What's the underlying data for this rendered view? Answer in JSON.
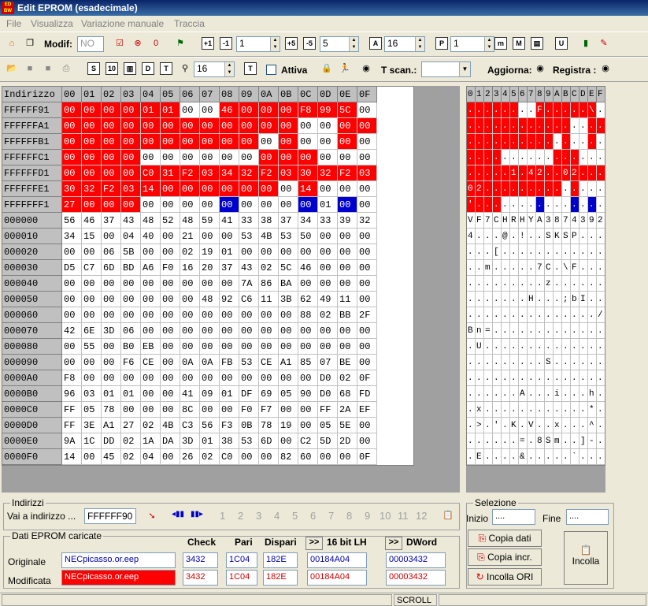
{
  "window": {
    "title": "Edit EPROM (esadecimale)",
    "icon_text": "ED\nBW"
  },
  "menu": [
    "File",
    "Visualizza",
    "Variazione manuale",
    "Traccia"
  ],
  "toolbar1": {
    "modif_label": "Modif:",
    "modif_value": "NO",
    "spin1": "1",
    "spin2": "5",
    "spin3": "16",
    "spin4": "1"
  },
  "toolbar2": {
    "spin_value": "16",
    "attiva_label": "Attiva",
    "tscan_label": "T scan.:",
    "aggiorna_label": "Aggiorna:",
    "registra_label": "Registra :"
  },
  "hex_headers": [
    "Indirizzo",
    "00",
    "01",
    "02",
    "03",
    "04",
    "05",
    "06",
    "07",
    "08",
    "09",
    "0A",
    "0B",
    "0C",
    "0D",
    "0E",
    "0F"
  ],
  "ascii_headers": [
    "0",
    "1",
    "2",
    "3",
    "4",
    "5",
    "6",
    "7",
    "8",
    "9",
    "A",
    "B",
    "C",
    "D",
    "E",
    "F"
  ],
  "hex_rows": [
    {
      "addr": "FFFFFF91",
      "cells": [
        "00",
        "00",
        "00",
        "00",
        "01",
        "01",
        "00",
        "00",
        "46",
        "00",
        "00",
        "00",
        "F8",
        "99",
        "5C",
        "00"
      ],
      "red": [
        1,
        1,
        1,
        1,
        1,
        1,
        0,
        0,
        1,
        1,
        1,
        1,
        1,
        1,
        1,
        0
      ]
    },
    {
      "addr": "FFFFFFA1",
      "cells": [
        "00",
        "00",
        "00",
        "00",
        "00",
        "00",
        "00",
        "00",
        "00",
        "00",
        "00",
        "00",
        "00",
        "00",
        "00",
        "00"
      ],
      "red": [
        1,
        1,
        1,
        1,
        1,
        1,
        1,
        1,
        1,
        1,
        1,
        1,
        0,
        0,
        1,
        1
      ]
    },
    {
      "addr": "FFFFFFB1",
      "cells": [
        "00",
        "00",
        "00",
        "00",
        "00",
        "00",
        "00",
        "00",
        "00",
        "00",
        "00",
        "00",
        "00",
        "00",
        "00",
        "00"
      ],
      "red": [
        1,
        1,
        1,
        1,
        1,
        1,
        1,
        1,
        1,
        1,
        0,
        1,
        0,
        0,
        1,
        0
      ]
    },
    {
      "addr": "FFFFFFC1",
      "cells": [
        "00",
        "00",
        "00",
        "00",
        "00",
        "00",
        "00",
        "00",
        "00",
        "00",
        "00",
        "00",
        "00",
        "00",
        "00",
        "00"
      ],
      "red": [
        1,
        1,
        1,
        1,
        0,
        0,
        0,
        0,
        0,
        0,
        1,
        1,
        1,
        0,
        0,
        0
      ]
    },
    {
      "addr": "FFFFFFD1",
      "cells": [
        "00",
        "00",
        "00",
        "00",
        "C0",
        "31",
        "F2",
        "03",
        "34",
        "32",
        "F2",
        "03",
        "30",
        "32",
        "F2",
        "03"
      ],
      "red": [
        1,
        1,
        1,
        1,
        1,
        1,
        1,
        1,
        1,
        1,
        1,
        1,
        1,
        1,
        1,
        1
      ]
    },
    {
      "addr": "FFFFFFE1",
      "cells": [
        "30",
        "32",
        "F2",
        "03",
        "14",
        "00",
        "00",
        "00",
        "00",
        "00",
        "00",
        "00",
        "14",
        "00",
        "00",
        "00"
      ],
      "red": [
        1,
        1,
        1,
        1,
        1,
        1,
        1,
        1,
        1,
        1,
        1,
        0,
        1,
        0,
        0,
        0
      ]
    },
    {
      "addr": "FFFFFFF1",
      "cells": [
        "27",
        "00",
        "00",
        "00",
        "00",
        "00",
        "00",
        "00",
        "00",
        "00",
        "00",
        "00",
        "00",
        "01",
        "00",
        "00"
      ],
      "red": [
        1,
        1,
        1,
        1,
        0,
        0,
        0,
        0,
        0,
        0,
        0,
        0,
        0,
        0,
        0,
        0
      ],
      "blue": [
        0,
        0,
        0,
        0,
        0,
        0,
        0,
        0,
        1,
        0,
        0,
        0,
        1,
        0,
        1,
        0
      ]
    },
    {
      "addr": "000000",
      "cells": [
        "56",
        "46",
        "37",
        "43",
        "48",
        "52",
        "48",
        "59",
        "41",
        "33",
        "38",
        "37",
        "34",
        "33",
        "39",
        "32"
      ]
    },
    {
      "addr": "000010",
      "cells": [
        "34",
        "15",
        "00",
        "04",
        "40",
        "00",
        "21",
        "00",
        "00",
        "53",
        "4B",
        "53",
        "50",
        "00",
        "00",
        "00"
      ]
    },
    {
      "addr": "000020",
      "cells": [
        "00",
        "00",
        "06",
        "5B",
        "00",
        "00",
        "02",
        "19",
        "01",
        "00",
        "00",
        "00",
        "00",
        "00",
        "00",
        "00"
      ]
    },
    {
      "addr": "000030",
      "cells": [
        "D5",
        "C7",
        "6D",
        "BD",
        "A6",
        "F0",
        "16",
        "20",
        "37",
        "43",
        "02",
        "5C",
        "46",
        "00",
        "00",
        "00"
      ]
    },
    {
      "addr": "000040",
      "cells": [
        "00",
        "00",
        "00",
        "00",
        "00",
        "00",
        "00",
        "00",
        "00",
        "7A",
        "86",
        "BA",
        "00",
        "00",
        "00",
        "00"
      ]
    },
    {
      "addr": "000050",
      "cells": [
        "00",
        "00",
        "00",
        "00",
        "00",
        "00",
        "00",
        "48",
        "92",
        "C6",
        "11",
        "3B",
        "62",
        "49",
        "11",
        "00"
      ]
    },
    {
      "addr": "000060",
      "cells": [
        "00",
        "00",
        "00",
        "00",
        "00",
        "00",
        "00",
        "00",
        "00",
        "00",
        "00",
        "00",
        "88",
        "02",
        "BB",
        "2F"
      ]
    },
    {
      "addr": "000070",
      "cells": [
        "42",
        "6E",
        "3D",
        "06",
        "00",
        "00",
        "00",
        "00",
        "00",
        "00",
        "00",
        "00",
        "00",
        "00",
        "00",
        "00"
      ]
    },
    {
      "addr": "000080",
      "cells": [
        "00",
        "55",
        "00",
        "B0",
        "EB",
        "00",
        "00",
        "00",
        "00",
        "00",
        "00",
        "00",
        "00",
        "00",
        "00",
        "00"
      ]
    },
    {
      "addr": "000090",
      "cells": [
        "00",
        "00",
        "00",
        "F6",
        "CE",
        "00",
        "0A",
        "0A",
        "FB",
        "53",
        "CE",
        "A1",
        "85",
        "07",
        "BE",
        "00"
      ]
    },
    {
      "addr": "0000A0",
      "cells": [
        "F8",
        "00",
        "00",
        "00",
        "00",
        "00",
        "00",
        "00",
        "00",
        "00",
        "00",
        "00",
        "00",
        "D0",
        "02",
        "0F"
      ]
    },
    {
      "addr": "0000B0",
      "cells": [
        "96",
        "03",
        "01",
        "01",
        "00",
        "00",
        "41",
        "09",
        "01",
        "DF",
        "69",
        "05",
        "90",
        "D0",
        "68",
        "FD"
      ]
    },
    {
      "addr": "0000C0",
      "cells": [
        "FF",
        "05",
        "78",
        "00",
        "00",
        "00",
        "8C",
        "00",
        "00",
        "F0",
        "F7",
        "00",
        "00",
        "FF",
        "2A",
        "EF"
      ]
    },
    {
      "addr": "0000D0",
      "cells": [
        "FF",
        "3E",
        "A1",
        "27",
        "02",
        "4B",
        "C3",
        "56",
        "F3",
        "0B",
        "78",
        "19",
        "00",
        "05",
        "5E",
        "00"
      ]
    },
    {
      "addr": "0000E0",
      "cells": [
        "9A",
        "1C",
        "DD",
        "02",
        "1A",
        "DA",
        "3D",
        "01",
        "38",
        "53",
        "6D",
        "00",
        "C2",
        "5D",
        "2D",
        "00"
      ]
    },
    {
      "addr": "0000F0",
      "cells": [
        "14",
        "00",
        "45",
        "02",
        "04",
        "00",
        "26",
        "02",
        "C0",
        "00",
        "00",
        "82",
        "60",
        "00",
        "00",
        "0F"
      ]
    }
  ],
  "ascii_rows": [
    {
      "chars": [
        ".",
        ".",
        ".",
        ".",
        ".",
        ".",
        ".",
        ".",
        "F",
        ".",
        ".",
        ".",
        ".",
        ".",
        "\\",
        "."
      ]
    },
    {
      "chars": [
        ".",
        ".",
        ".",
        ".",
        ".",
        ".",
        ".",
        ".",
        ".",
        ".",
        ".",
        ".",
        ".",
        ".",
        ".",
        "."
      ]
    },
    {
      "chars": [
        ".",
        ".",
        ".",
        ".",
        ".",
        ".",
        ".",
        ".",
        ".",
        ".",
        ".",
        ".",
        ".",
        ".",
        ".",
        "."
      ]
    },
    {
      "chars": [
        ".",
        ".",
        ".",
        ".",
        ".",
        ".",
        ".",
        ".",
        ".",
        ".",
        ".",
        ".",
        ".",
        ".",
        ".",
        "."
      ]
    },
    {
      "chars": [
        ".",
        ".",
        ".",
        ".",
        ".",
        "1",
        ".",
        "4",
        "2",
        ".",
        ".",
        "0",
        "2",
        ".",
        ".",
        "."
      ]
    },
    {
      "chars": [
        "0",
        "2",
        ".",
        ".",
        ".",
        ".",
        ".",
        ".",
        ".",
        ".",
        ".",
        ".",
        ".",
        ".",
        ".",
        "."
      ]
    },
    {
      "chars": [
        "'",
        ".",
        ".",
        ".",
        ".",
        ".",
        ".",
        ".",
        ".",
        ".",
        ".",
        ".",
        ".",
        ".",
        ".",
        "."
      ]
    },
    {
      "chars": [
        "V",
        "F",
        "7",
        "C",
        "H",
        "R",
        "H",
        "Y",
        "A",
        "3",
        "8",
        "7",
        "4",
        "3",
        "9",
        "2"
      ]
    },
    {
      "chars": [
        "4",
        ".",
        ".",
        ".",
        "@",
        ".",
        "!",
        ".",
        ".",
        "S",
        "K",
        "S",
        "P",
        ".",
        ".",
        "."
      ]
    },
    {
      "chars": [
        ".",
        ".",
        ".",
        "[",
        ".",
        ".",
        ".",
        ".",
        ".",
        ".",
        ".",
        ".",
        ".",
        ".",
        ".",
        "."
      ]
    },
    {
      "chars": [
        ".",
        ".",
        "m",
        ".",
        ".",
        ".",
        ".",
        ".",
        "7",
        "C",
        ".",
        "\\",
        "F",
        ".",
        ".",
        "."
      ]
    },
    {
      "chars": [
        ".",
        ".",
        ".",
        ".",
        ".",
        ".",
        ".",
        ".",
        ".",
        "z",
        ".",
        ".",
        ".",
        ".",
        ".",
        "."
      ]
    },
    {
      "chars": [
        ".",
        ".",
        ".",
        ".",
        ".",
        ".",
        ".",
        "H",
        ".",
        ".",
        ".",
        ";",
        "b",
        "I",
        ".",
        "."
      ]
    },
    {
      "chars": [
        ".",
        ".",
        ".",
        ".",
        ".",
        ".",
        ".",
        ".",
        ".",
        ".",
        ".",
        ".",
        ".",
        ".",
        ".",
        "/"
      ]
    },
    {
      "chars": [
        "B",
        "n",
        "=",
        ".",
        ".",
        ".",
        ".",
        ".",
        ".",
        ".",
        ".",
        ".",
        ".",
        ".",
        ".",
        "."
      ]
    },
    {
      "chars": [
        ".",
        "U",
        ".",
        ".",
        ".",
        ".",
        ".",
        ".",
        ".",
        ".",
        ".",
        ".",
        ".",
        ".",
        ".",
        "."
      ]
    },
    {
      "chars": [
        ".",
        ".",
        ".",
        ".",
        ".",
        ".",
        ".",
        ".",
        ".",
        "S",
        ".",
        ".",
        ".",
        ".",
        ".",
        "."
      ]
    },
    {
      "chars": [
        ".",
        ".",
        ".",
        ".",
        ".",
        ".",
        ".",
        ".",
        ".",
        ".",
        ".",
        ".",
        ".",
        ".",
        ".",
        "."
      ]
    },
    {
      "chars": [
        ".",
        ".",
        ".",
        ".",
        ".",
        ".",
        "A",
        ".",
        ".",
        ".",
        "i",
        ".",
        ".",
        ".",
        "h",
        "."
      ]
    },
    {
      "chars": [
        ".",
        "x",
        ".",
        ".",
        ".",
        ".",
        ".",
        ".",
        ".",
        ".",
        ".",
        ".",
        ".",
        ".",
        "*",
        "."
      ]
    },
    {
      "chars": [
        ".",
        ">",
        ".",
        "'",
        ".",
        "K",
        ".",
        "V",
        ".",
        ".",
        "x",
        ".",
        ".",
        ".",
        "^",
        "."
      ]
    },
    {
      "chars": [
        ".",
        ".",
        ".",
        ".",
        ".",
        ".",
        "=",
        ".",
        "8",
        "S",
        "m",
        ".",
        ".",
        "]",
        "-",
        "."
      ]
    },
    {
      "chars": [
        ".",
        "E",
        ".",
        ".",
        ".",
        ".",
        "&",
        ".",
        ".",
        ".",
        ".",
        ".",
        "`",
        ".",
        ".",
        "."
      ]
    }
  ],
  "indirizzi": {
    "legend": "Indirizzi",
    "goto_label": "Vai a indirizzo ...",
    "goto_value": "FFFFFF90",
    "pages": [
      "1",
      "2",
      "3",
      "4",
      "5",
      "6",
      "7",
      "8",
      "9",
      "10",
      "11",
      "12"
    ]
  },
  "selezione": {
    "legend": "Selezione",
    "inizio_label": "Inizio",
    "inizio_value": "....",
    "fine_label": "Fine",
    "fine_value": "...."
  },
  "dati": {
    "legend": "Dati EPROM caricate",
    "col_check": "Check",
    "col_pari": "Pari",
    "col_dispari": "Dispari",
    "col_16bit": "16 bit LH",
    "col_dword": "DWord",
    "nav_label": ">>",
    "originale": {
      "label": "Originale",
      "file": "NECpicasso.or.eep",
      "check": "3432",
      "pari": "1C04",
      "dispari": "182E",
      "bit16": "00184A04",
      "dword": "00003432"
    },
    "modificata": {
      "label": "Modificata",
      "file": "NECpicasso.or.eep",
      "check": "3432",
      "pari": "1C04",
      "dispari": "182E",
      "bit16": "00184A04",
      "dword": "00003432"
    }
  },
  "buttons": {
    "copia_dati": "Copia dati",
    "copia_incr": "Copia incr.",
    "incolla_ori": "Incolla ORI",
    "incolla": "Incolla"
  },
  "status": {
    "scroll": "SCROLL"
  }
}
